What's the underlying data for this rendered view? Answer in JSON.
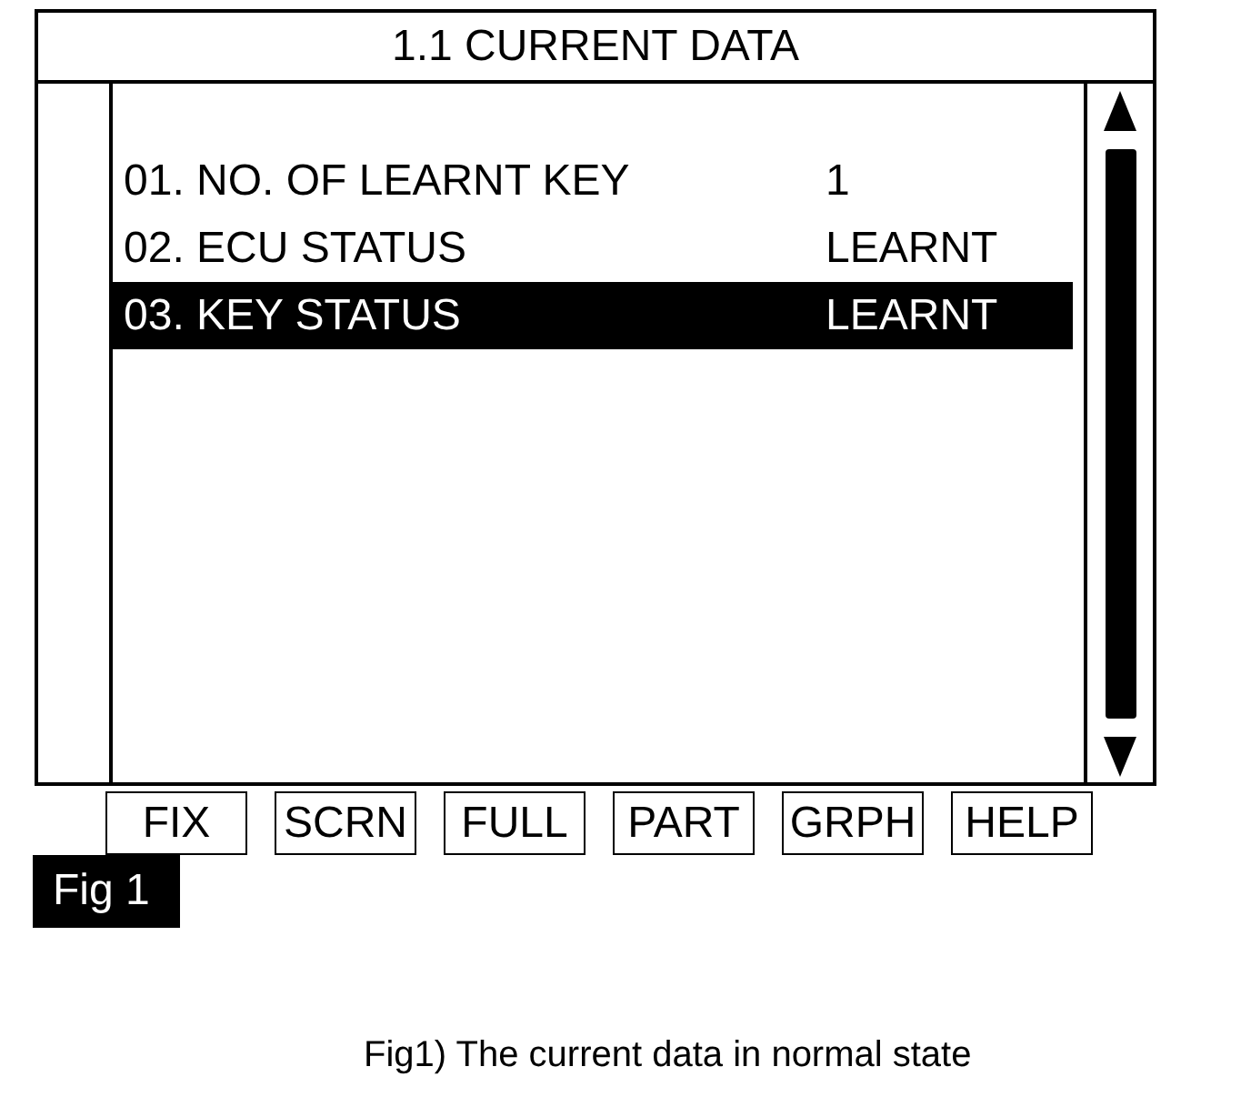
{
  "screen": {
    "title": "1.1 CURRENT DATA",
    "rows": [
      {
        "label": "01. NO. OF LEARNT KEY",
        "value": "1",
        "selected": false
      },
      {
        "label": "02. ECU STATUS",
        "value": "LEARNT",
        "selected": false
      },
      {
        "label": "03. KEY STATUS",
        "value": "LEARNT",
        "selected": true
      }
    ],
    "function_keys": [
      "FIX",
      "SCRN",
      "FULL",
      "PART",
      "GRPH",
      "HELP"
    ]
  },
  "figure_label": "Fig 1",
  "caption": "Fig1) The current data in normal state"
}
